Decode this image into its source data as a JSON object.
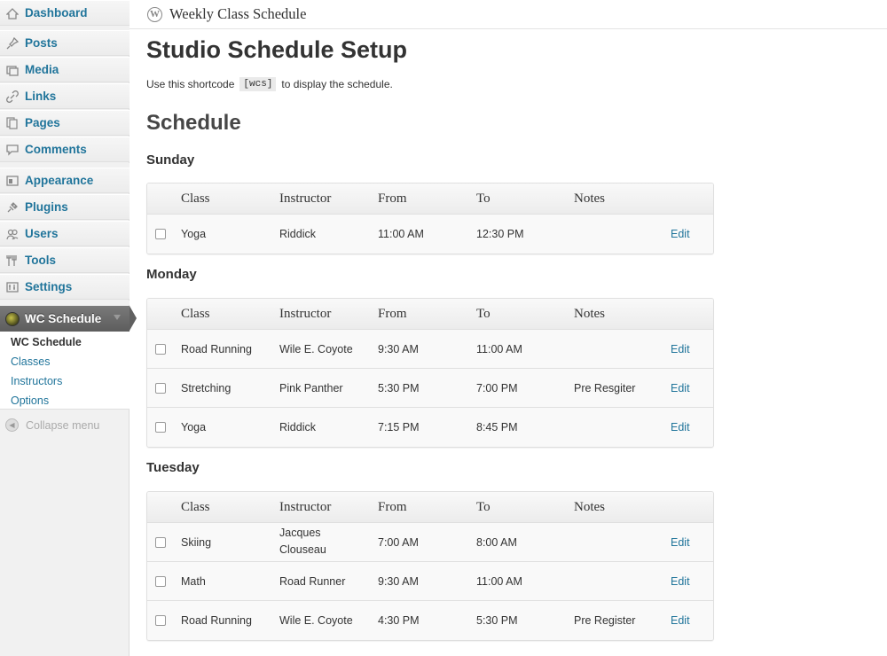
{
  "sidebar": {
    "items": [
      {
        "label": "Dashboard",
        "icon": "dashboard-icon"
      },
      {
        "label": "Posts",
        "icon": "pin-icon"
      },
      {
        "label": "Media",
        "icon": "media-icon"
      },
      {
        "label": "Links",
        "icon": "link-icon"
      },
      {
        "label": "Pages",
        "icon": "pages-icon"
      },
      {
        "label": "Comments",
        "icon": "comment-icon"
      },
      {
        "label": "Appearance",
        "icon": "appearance-icon"
      },
      {
        "label": "Plugins",
        "icon": "plugin-icon"
      },
      {
        "label": "Users",
        "icon": "users-icon"
      },
      {
        "label": "Tools",
        "icon": "tools-icon"
      },
      {
        "label": "Settings",
        "icon": "settings-icon"
      }
    ],
    "active": {
      "label": "WC Schedule",
      "icon": "globe-icon"
    },
    "submenu": [
      "WC Schedule",
      "Classes",
      "Instructors",
      "Options"
    ],
    "collapse_label": "Collapse menu"
  },
  "header": {
    "site_title": "Weekly Class Schedule",
    "logo_glyph": "W"
  },
  "main": {
    "page_title": "Studio Schedule Setup",
    "intro_before": "Use this shortcode",
    "shortcode": "[wcs]",
    "intro_after": "to display the schedule.",
    "section_title": "Schedule",
    "columns": [
      "Class",
      "Instructor",
      "From",
      "To",
      "Notes"
    ],
    "edit_label": "Edit",
    "days": [
      {
        "name": "Sunday",
        "rows": [
          {
            "class": "Yoga",
            "instructor": "Riddick",
            "from": "11:00 AM",
            "to": "12:30 PM",
            "notes": ""
          }
        ]
      },
      {
        "name": "Monday",
        "rows": [
          {
            "class": "Road Running",
            "instructor": "Wile E. Coyote",
            "from": "9:30 AM",
            "to": "11:00 AM",
            "notes": ""
          },
          {
            "class": "Stretching",
            "instructor": "Pink Panther",
            "from": "5:30 PM",
            "to": "7:00 PM",
            "notes": "Pre Resgiter"
          },
          {
            "class": "Yoga",
            "instructor": "Riddick",
            "from": "7:15 PM",
            "to": "8:45 PM",
            "notes": ""
          }
        ]
      },
      {
        "name": "Tuesday",
        "rows": [
          {
            "class": "Skiing",
            "instructor": "Jacques Clouseau",
            "from": "7:00 AM",
            "to": "8:00 AM",
            "notes": ""
          },
          {
            "class": "Math",
            "instructor": "Road Runner",
            "from": "9:30 AM",
            "to": "11:00 AM",
            "notes": ""
          },
          {
            "class": "Road Running",
            "instructor": "Wile E. Coyote",
            "from": "4:30 PM",
            "to": "5:30 PM",
            "notes": "Pre Register"
          }
        ]
      }
    ]
  },
  "colors": {
    "link": "#21759b",
    "active_menu": "#5d5d5d"
  }
}
